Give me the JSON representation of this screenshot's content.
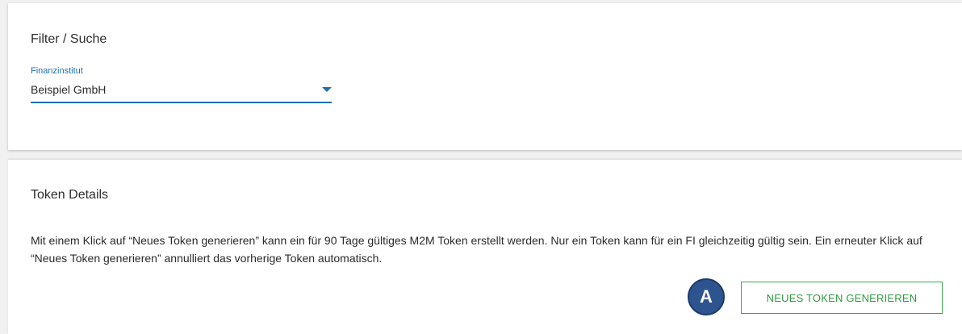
{
  "filter": {
    "title": "Filter / Suche",
    "finanzinstitut": {
      "label": "Finanzinstitut",
      "value": "Beispiel GmbH",
      "icon": "caret-down-icon"
    }
  },
  "token": {
    "title": "Token Details",
    "description": "Mit einem Klick auf “Neues Token generieren” kann ein für 90 Tage gültiges M2M Token erstellt werden. Nur ein Token kann für ein FI gleichzeitig gültig sein. Ein erneuter Klick auf “Neues Token generieren” annulliert das vorherige Token automatisch.",
    "badge_label": "A",
    "generate_button_label": "NEUES TOKEN GENERIEREN"
  },
  "colors": {
    "accent": "#1f6fae",
    "button": "#3aa84a",
    "badge": "#2e548f"
  }
}
